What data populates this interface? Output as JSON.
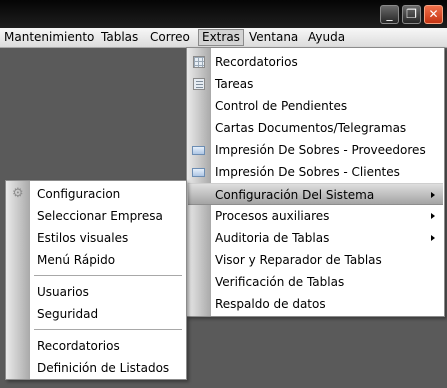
{
  "menubar": {
    "items": [
      "Mantenimiento",
      "Tablas",
      "Correo",
      "Extras",
      "Ventana",
      "Ayuda"
    ],
    "active": "Extras"
  },
  "window_buttons": {
    "minimize_glyph": "_",
    "restore_glyph": "❐",
    "close_glyph": "✕"
  },
  "extras_menu": {
    "items": [
      {
        "label": "Recordatorios",
        "icon": "grid-icon"
      },
      {
        "label": "Tareas",
        "icon": "list-icon"
      },
      {
        "label": "Control de Pendientes"
      },
      {
        "label": "Cartas Documentos/Telegramas"
      },
      {
        "label": "Impresión De Sobres - Proveedores",
        "icon": "envelope-icon"
      },
      {
        "label": "Impresión De Sobres - Clientes",
        "icon": "envelope-icon"
      },
      {
        "label": "Configuración Del Sistema",
        "submenu": true,
        "highlighted": true
      },
      {
        "label": "Procesos auxiliares",
        "submenu": true
      },
      {
        "label": "Auditoria de Tablas",
        "submenu": true
      },
      {
        "label": "Visor y Reparador de Tablas"
      },
      {
        "label": "Verificación de Tablas"
      },
      {
        "label": "Respaldo de datos"
      }
    ]
  },
  "config_submenu": {
    "groups": [
      [
        {
          "label": "Configuracion",
          "icon": "gear-icon"
        },
        {
          "label": "Seleccionar Empresa"
        },
        {
          "label": "Estilos visuales"
        },
        {
          "label": "Menú Rápido"
        }
      ],
      [
        {
          "label": "Usuarios"
        },
        {
          "label": "Seguridad"
        }
      ],
      [
        {
          "label": "Recordatorios"
        },
        {
          "label": "Definición de Listados"
        }
      ]
    ]
  },
  "colors": {
    "workspace": "#5a5a5a",
    "titlebar": "#0a0a0a",
    "close_button": "#e0522a",
    "highlight": "#b9b9b9"
  }
}
